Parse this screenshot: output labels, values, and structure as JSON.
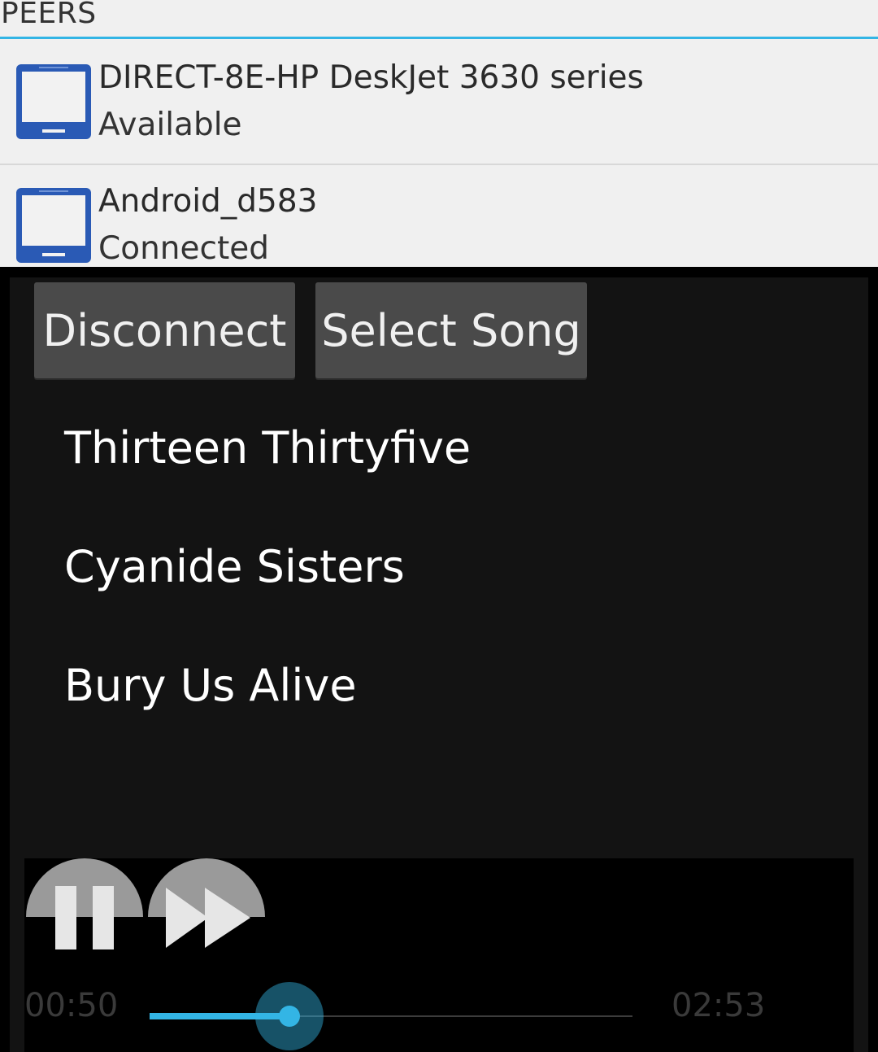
{
  "peers": {
    "header": "PEERS",
    "items": [
      {
        "name": "DIRECT-8E-HP DeskJet 3630 series",
        "status": "Available",
        "icon": "device-icon"
      },
      {
        "name": "Android_d583",
        "status": "Connected",
        "icon": "device-icon"
      }
    ]
  },
  "actions": {
    "disconnect_label": "Disconnect",
    "select_song_label": "Select Song"
  },
  "songs": [
    {
      "title": "Thirteen Thirtyfive"
    },
    {
      "title": "Cyanide Sisters"
    },
    {
      "title": "Bury Us Alive"
    }
  ],
  "player": {
    "current_time": "00:50",
    "total_time": "02:53",
    "progress_fraction": 0.289,
    "controls": [
      "pause-icon",
      "fast-forward-icon"
    ]
  },
  "colors": {
    "accent": "#33b5e5",
    "device_icon": "#2a5ab5",
    "panel_bg": "#f0f0f0",
    "player_bg": "#131313"
  }
}
